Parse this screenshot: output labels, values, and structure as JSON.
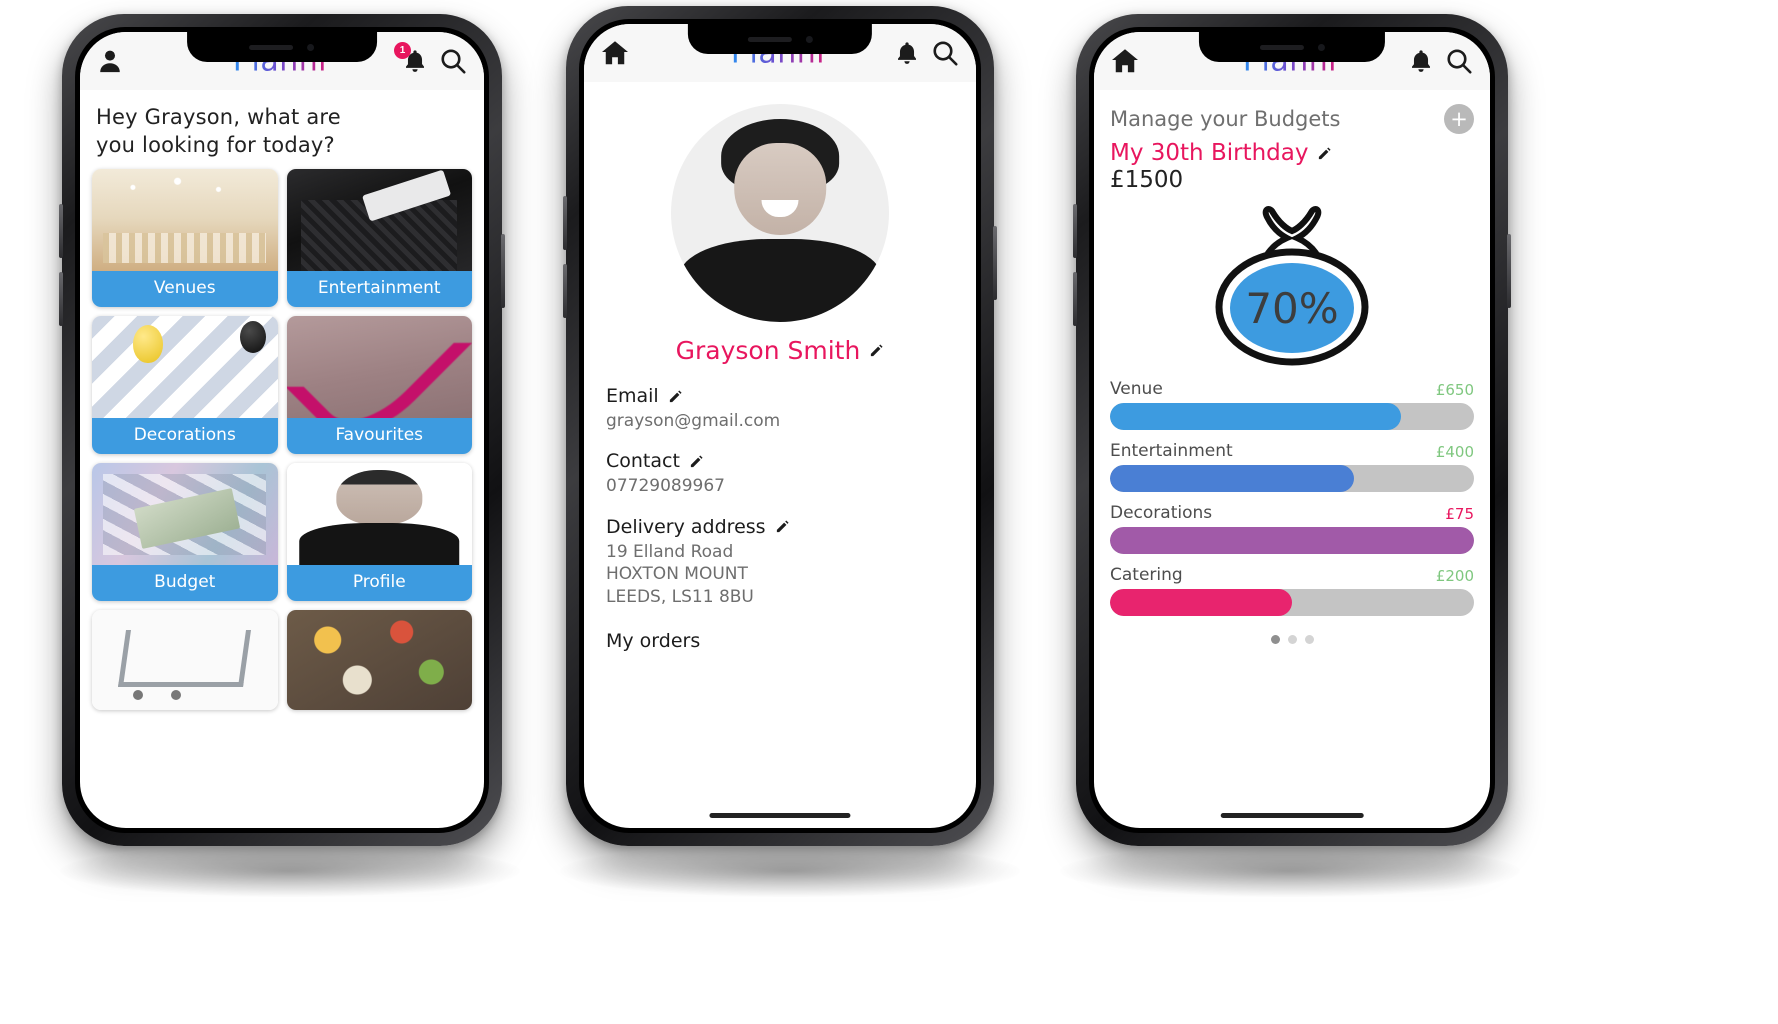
{
  "app": {
    "brand": "Plannr"
  },
  "phone1": {
    "header": {
      "profile_icon": "person-icon",
      "bell_icon": "bell-icon",
      "notification_count": "1",
      "search_icon": "search-icon"
    },
    "greeting_line1": "Hey Grayson, what are",
    "greeting_line2": "you looking for today?",
    "tiles": [
      {
        "label": "Venues",
        "image": "venue-photo"
      },
      {
        "label": "Entertainment",
        "image": "entertainment-photo"
      },
      {
        "label": "Decorations",
        "image": "decorations-photo"
      },
      {
        "label": "Favourites",
        "image": "favourites-photo"
      },
      {
        "label": "Budget",
        "image": "budget-photo"
      },
      {
        "label": "Profile",
        "image": "profile-photo"
      },
      {
        "label": "",
        "image": "cart-photo"
      },
      {
        "label": "",
        "image": "food-photo"
      }
    ]
  },
  "phone2": {
    "header": {
      "home_icon": "home-icon",
      "bell_icon": "bell-icon",
      "search_icon": "search-icon"
    },
    "avatar": "user-photo",
    "name": "Grayson Smith",
    "fields": [
      {
        "label": "Email",
        "value": "grayson@gmail.com"
      },
      {
        "label": "Contact",
        "value": "07729089967"
      },
      {
        "label": "Delivery address",
        "value": "19 Elland Road\nHOXTON MOUNT\nLEEDS, LS11 8BU"
      }
    ],
    "orders_link": "My orders"
  },
  "phone3": {
    "header": {
      "home_icon": "home-icon",
      "bell_icon": "bell-icon",
      "search_icon": "search-icon"
    },
    "title": "Manage your Budgets",
    "add_label": "+",
    "event_name": "My 30th Birthday",
    "total": "£1500",
    "bag_percent": "70%",
    "rows": [
      {
        "name": "Venue",
        "amount": "£650",
        "amount_color": "#7fc77f",
        "fill_color": "#3d9be0",
        "percent": 80
      },
      {
        "name": "Entertainment",
        "amount": "£400",
        "amount_color": "#7fc77f",
        "fill_color": "#4a7fd4",
        "percent": 67
      },
      {
        "name": "Decorations",
        "amount": "£75",
        "amount_color": "#e8165e",
        "fill_color": "#a15aa8",
        "percent": 100
      },
      {
        "name": "Catering",
        "amount": "£200",
        "amount_color": "#7fc77f",
        "fill_color": "#e8246e",
        "percent": 50
      }
    ],
    "dots": [
      true,
      false,
      false
    ]
  },
  "colors": {
    "brand_blue": "#2d8cf0",
    "brand_pink": "#d81b7a",
    "tile_blue": "#3d9be0",
    "accent_pink": "#e8165e"
  }
}
